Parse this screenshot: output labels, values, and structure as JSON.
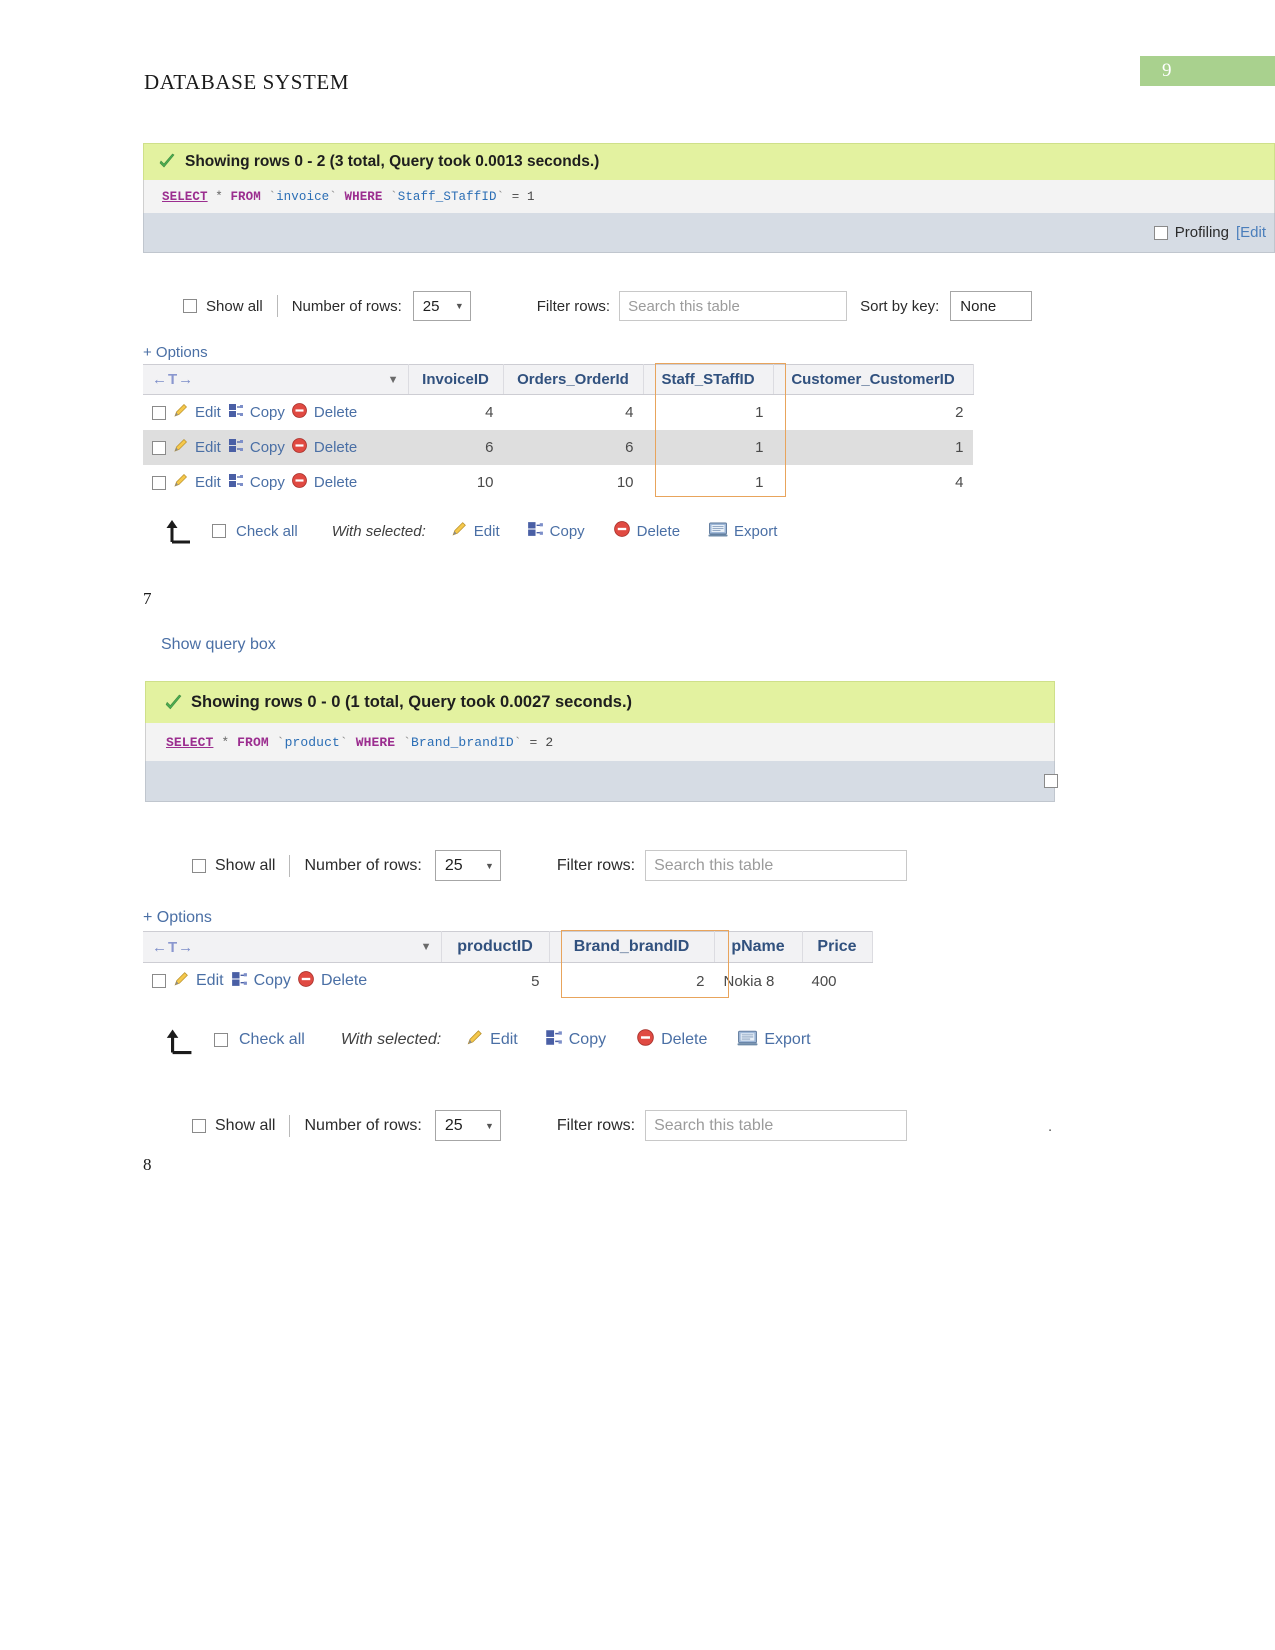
{
  "document": {
    "title": "DATABASE SYSTEM",
    "page_number": "9",
    "page_badge_color": "#a9d18e",
    "note_7": "7",
    "note_8": "8",
    "trailing_dot": "."
  },
  "result_1": {
    "success_text": "Showing rows 0 - 2 (3 total, Query took 0.0013 seconds.)",
    "check_icon": "green-check-icon",
    "sql": {
      "keyword_select": "SELECT",
      "star": "*",
      "keyword_from": "FROM",
      "table": "invoice",
      "keyword_where": "WHERE",
      "column": "Staff_STaffID",
      "operator": "=",
      "value": "1",
      "full": "SELECT * FROM `invoice` WHERE `Staff_STaffID` = 1"
    },
    "profiling_label": "Profiling",
    "profiling_checked": false,
    "edit_link": "[Edit",
    "controls": {
      "show_all_label": "Show all",
      "show_all_checked": false,
      "number_of_rows_label": "Number of rows:",
      "number_of_rows_value": "25",
      "filter_rows_label": "Filter rows:",
      "filter_placeholder": "Search this table",
      "sort_by_key_label": "Sort by key:",
      "sort_by_key_value": "None"
    },
    "options_link": "+ Options",
    "table": {
      "sort_column_header": "",
      "headers": [
        "InvoiceID",
        "Orders_OrderId",
        "Staff_STaffID",
        "Customer_CustomerID"
      ],
      "highlighted_header": "Staff_STaffID",
      "highlight_color": "#e8a45c",
      "row_action_labels": {
        "edit": "Edit",
        "copy": "Copy",
        "delete": "Delete"
      },
      "rows": [
        {
          "InvoiceID": "4",
          "Orders_OrderId": "4",
          "Staff_STaffID": "1",
          "Customer_CustomerID": "2"
        },
        {
          "InvoiceID": "6",
          "Orders_OrderId": "6",
          "Staff_STaffID": "1",
          "Customer_CustomerID": "1"
        },
        {
          "InvoiceID": "10",
          "Orders_OrderId": "10",
          "Staff_STaffID": "1",
          "Customer_CustomerID": "4"
        }
      ]
    },
    "footer": {
      "check_all_label": "Check all",
      "check_all_checked": false,
      "with_selected_label": "With selected:",
      "edit_label": "Edit",
      "copy_label": "Copy",
      "delete_label": "Delete",
      "export_label": "Export"
    }
  },
  "result_2": {
    "show_query_box_link": "Show query box",
    "success_text": "Showing rows 0 - 0 (1 total, Query took 0.0027 seconds.)",
    "check_icon": "green-check-icon",
    "sql": {
      "keyword_select": "SELECT",
      "star": "*",
      "keyword_from": "FROM",
      "table": "product",
      "keyword_where": "WHERE",
      "column": "Brand_brandID",
      "operator": "=",
      "value": "2",
      "full": "SELECT * FROM `product` WHERE `Brand_brandID` = 2"
    },
    "profiling_checked": false,
    "controls": {
      "show_all_label": "Show all",
      "show_all_checked": false,
      "number_of_rows_label": "Number of rows:",
      "number_of_rows_value": "25",
      "filter_rows_label": "Filter rows:",
      "filter_placeholder": "Search this table"
    },
    "options_link": "+ Options",
    "table": {
      "headers": [
        "productID",
        "Brand_brandID",
        "pName",
        "Price"
      ],
      "highlighted_header": "Brand_brandID",
      "highlight_color": "#e8a45c",
      "row_action_labels": {
        "edit": "Edit",
        "copy": "Copy",
        "delete": "Delete"
      },
      "rows": [
        {
          "productID": "5",
          "Brand_brandID": "2",
          "pName": "Nokia 8",
          "Price": "400"
        }
      ]
    },
    "footer": {
      "check_all_label": "Check all",
      "check_all_checked": false,
      "with_selected_label": "With selected:",
      "edit_label": "Edit",
      "copy_label": "Copy",
      "delete_label": "Delete",
      "export_label": "Export"
    },
    "controls_bottom": {
      "show_all_label": "Show all",
      "show_all_checked": false,
      "number_of_rows_label": "Number of rows:",
      "number_of_rows_value": "25",
      "filter_rows_label": "Filter rows:",
      "filter_placeholder": "Search this table"
    }
  }
}
